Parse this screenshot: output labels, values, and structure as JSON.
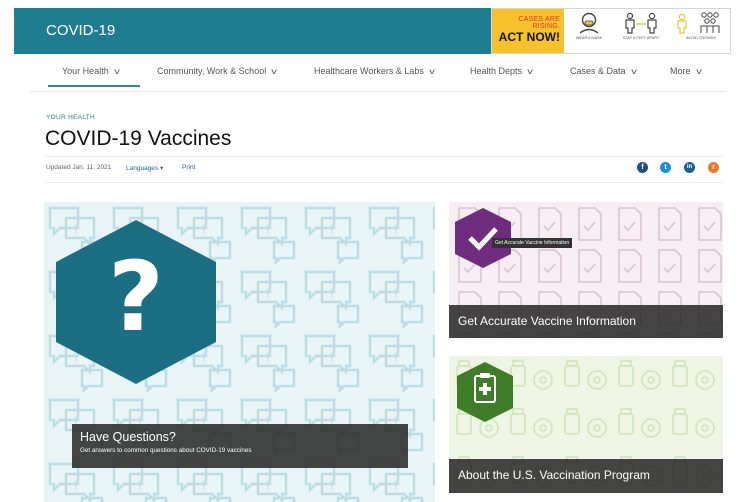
{
  "header": {
    "brand": "COVID-19",
    "promo": {
      "line1": "CASES ARE RISING.",
      "line2": "ACT NOW!",
      "items": [
        "WEAR A MASK",
        "STAY 6 FEET APART",
        "AVOID CROWDS"
      ]
    }
  },
  "nav": {
    "items": [
      {
        "label": "Your Health"
      },
      {
        "label": "Community, Work & School"
      },
      {
        "label": "Healthcare Workers & Labs"
      },
      {
        "label": "Health Depts"
      },
      {
        "label": "Cases & Data"
      },
      {
        "label": "More"
      }
    ]
  },
  "page": {
    "eyebrow": "YOUR HEALTH",
    "title": "COVID-19 Vaccines",
    "updated": "Updated Jan. 11, 2021",
    "languages": "Languages",
    "print": "Print"
  },
  "social": [
    {
      "icon": "facebook-icon",
      "glyph": "f",
      "color": "#1f4f88"
    },
    {
      "icon": "twitter-icon",
      "glyph": "t",
      "color": "#1f8fd8"
    },
    {
      "icon": "linkedin-icon",
      "glyph": "in",
      "color": "#11609a"
    },
    {
      "icon": "reddit-icon",
      "glyph": "r",
      "color": "#ea7a2e"
    }
  ],
  "cards": {
    "questions": {
      "title": "Have Questions?",
      "subtitle": "Get answers to common questions about COVID-19 vaccines"
    },
    "accurate": {
      "title": "Get Accurate Vaccine Information",
      "tooltip": "Get Accurate Vaccine Information"
    },
    "program": {
      "title": "About the U.S. Vaccination Program"
    }
  },
  "colors": {
    "header": "#1f7d92",
    "accent": "#f6c12a",
    "teal_hex": "#1c6e82",
    "purple_hex": "#6e2d7e",
    "green_hex": "#3f7d28"
  }
}
